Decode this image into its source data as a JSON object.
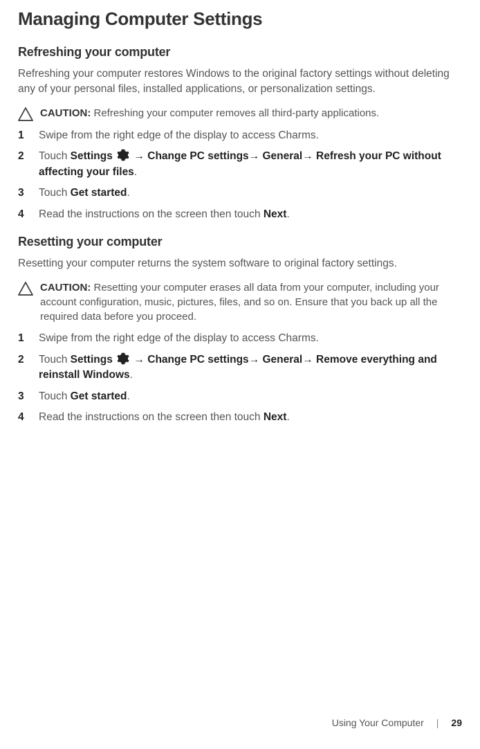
{
  "page_title": "Managing Computer Settings",
  "section1": {
    "heading": "Refreshing your computer",
    "intro": "Refreshing your computer restores Windows to the original factory settings without deleting any of your personal files, installed applications, or personalization settings.",
    "caution_label": "CAUTION:",
    "caution_text": " Refreshing your computer removes all third-party applications.",
    "steps": {
      "s1": "Swipe from the right edge of the display to access Charms.",
      "s2_pre": "Touch ",
      "s2_settings": "Settings",
      "s2_arrow": " → ",
      "s2_change": "Change PC settings",
      "s2_general": "→ General",
      "s2_refresh": "→ Refresh your PC without affecting your files",
      "s2_end": ".",
      "s3_pre": "Touch ",
      "s3_get": "Get started",
      "s3_end": ".",
      "s4_pre": "Read the instructions on the screen then touch ",
      "s4_next": "Next",
      "s4_end": "."
    }
  },
  "section2": {
    "heading": "Resetting your computer",
    "intro": "Resetting your computer returns the system software to original factory settings.",
    "caution_label": "CAUTION:",
    "caution_text": " Resetting your computer erases all data from your computer, including your account configuration, music, pictures, files, and so on. Ensure that you back up all the required data before you proceed.",
    "steps": {
      "s1": "Swipe from the right edge of the display to access Charms.",
      "s2_pre": "Touch ",
      "s2_settings": "Settings",
      "s2_arrow": " → ",
      "s2_change": "Change PC settings",
      "s2_general": "→ General",
      "s2_remove": "→ Remove everything and reinstall Windows",
      "s2_end": ".",
      "s3_pre": "Touch ",
      "s3_get": "Get started",
      "s3_end": ".",
      "s4_pre": "Read the instructions on the screen then touch ",
      "s4_next": "Next",
      "s4_end": "."
    }
  },
  "footer": {
    "chapter": "Using Your Computer",
    "separator": "|",
    "page": "29"
  }
}
